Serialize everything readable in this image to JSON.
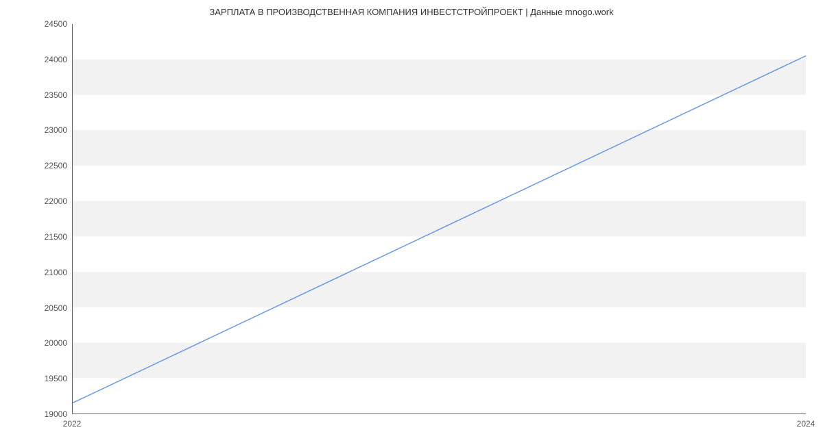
{
  "chart_data": {
    "type": "line",
    "title": "ЗАРПЛАТА В  ПРОИЗВОДСТВЕННАЯ КОМПАНИЯ ИНВЕСТСТРОЙПРОЕКТ | Данные mnogo.work",
    "xlabel": "",
    "ylabel": "",
    "x": [
      2022,
      2024
    ],
    "values": [
      19150,
      24050
    ],
    "x_ticks": [
      2022,
      2024
    ],
    "y_ticks": [
      19000,
      19500,
      20000,
      20500,
      21000,
      21500,
      22000,
      22500,
      23000,
      23500,
      24000,
      24500
    ],
    "ylim": [
      19000,
      24500
    ],
    "xlim": [
      2022,
      2024
    ]
  }
}
